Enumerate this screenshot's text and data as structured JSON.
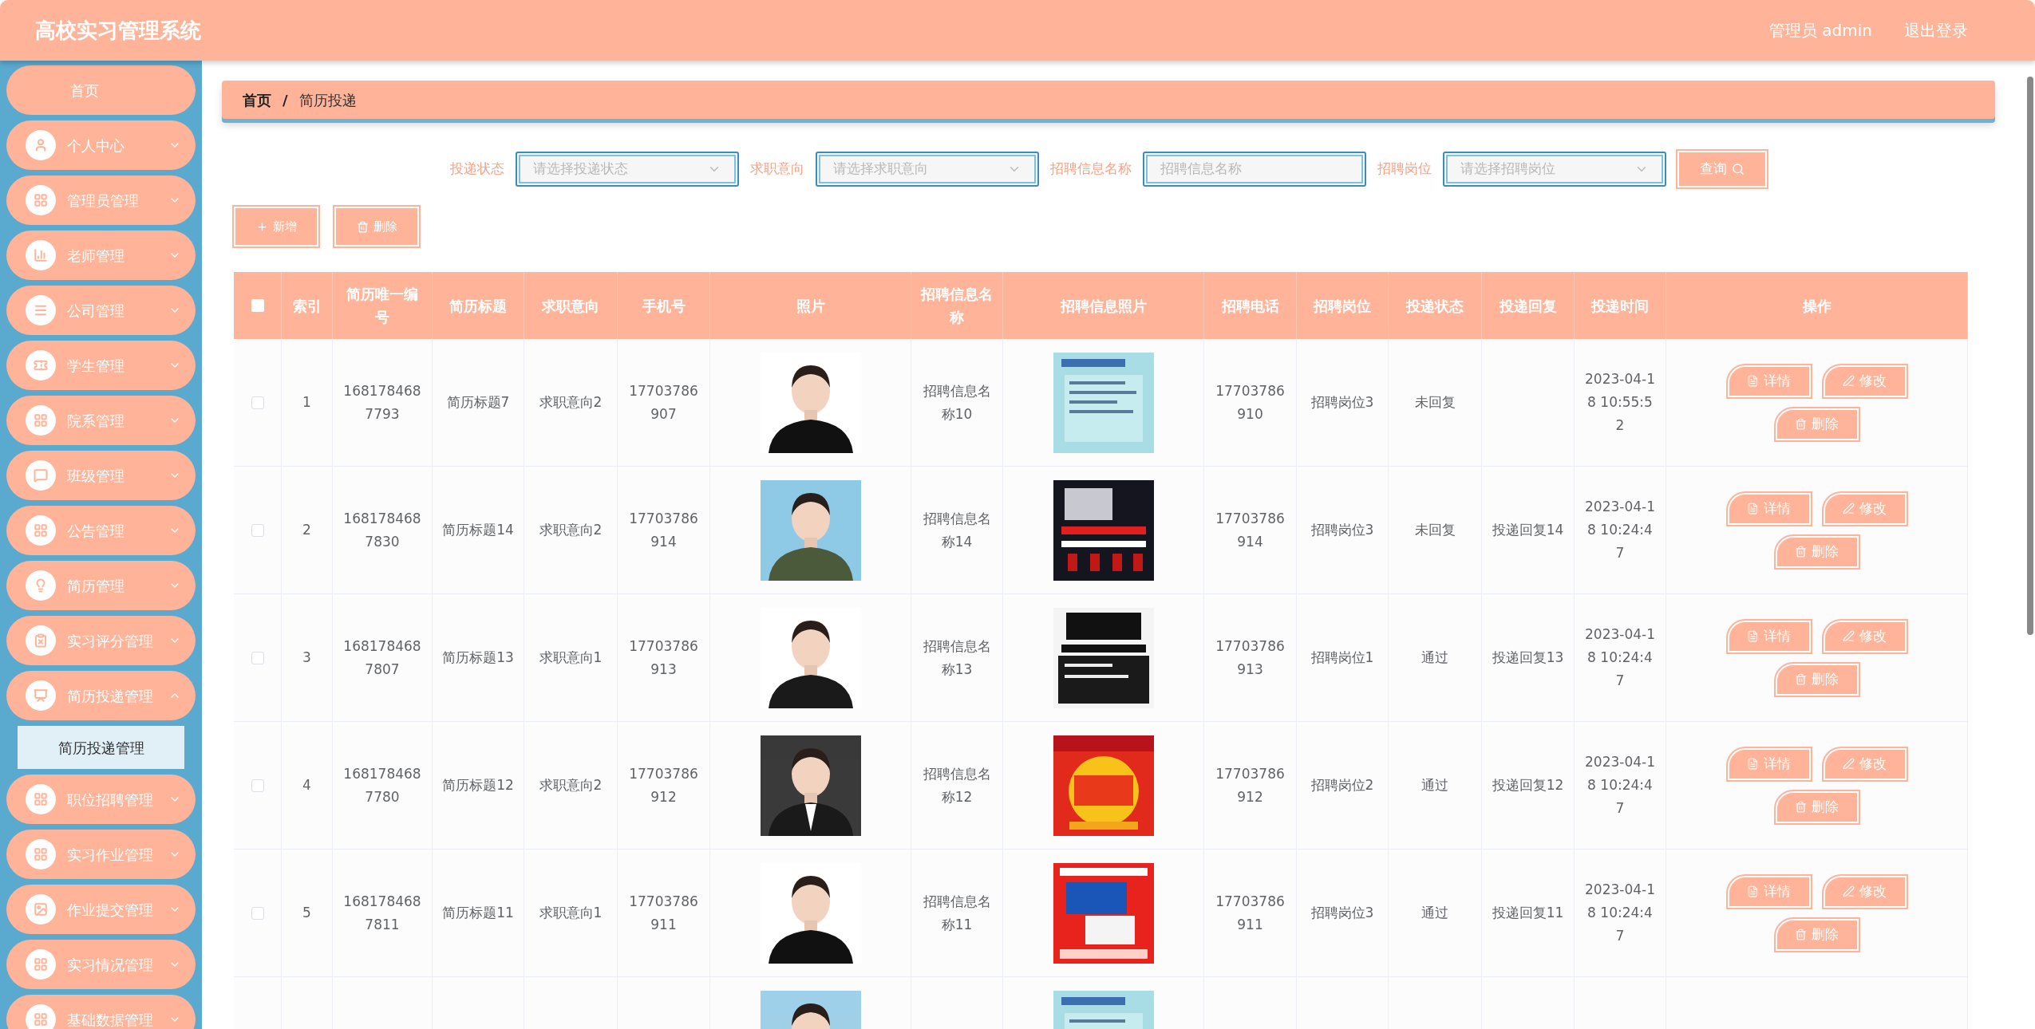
{
  "header": {
    "title": "高校实习管理系统",
    "user": "管理员 admin",
    "logout": "退出登录"
  },
  "sidebar": {
    "items": [
      {
        "label": "首页",
        "kind": "link"
      },
      {
        "label": "个人中心",
        "kind": "menu",
        "expanded": false
      },
      {
        "label": "管理员管理",
        "kind": "menu",
        "expanded": false
      },
      {
        "label": "老师管理",
        "kind": "menu",
        "expanded": false
      },
      {
        "label": "公司管理",
        "kind": "menu",
        "expanded": false
      },
      {
        "label": "学生管理",
        "kind": "menu",
        "expanded": false
      },
      {
        "label": "院系管理",
        "kind": "menu",
        "expanded": false
      },
      {
        "label": "班级管理",
        "kind": "menu",
        "expanded": false
      },
      {
        "label": "公告管理",
        "kind": "menu",
        "expanded": false
      },
      {
        "label": "简历管理",
        "kind": "menu",
        "expanded": false
      },
      {
        "label": "实习评分管理",
        "kind": "menu",
        "expanded": false
      },
      {
        "label": "简历投递管理",
        "kind": "menu",
        "expanded": true,
        "children": [
          {
            "label": "简历投递管理",
            "selected": true
          }
        ]
      },
      {
        "label": "职位招聘管理",
        "kind": "menu",
        "expanded": false
      },
      {
        "label": "实习作业管理",
        "kind": "menu",
        "expanded": false
      },
      {
        "label": "作业提交管理",
        "kind": "menu",
        "expanded": false
      },
      {
        "label": "实习情况管理",
        "kind": "menu",
        "expanded": false
      },
      {
        "label": "基础数据管理",
        "kind": "menu",
        "expanded": false
      }
    ]
  },
  "breadcrumb": {
    "items": [
      "首页",
      "简历投递"
    ],
    "separator": "/"
  },
  "filters": [
    {
      "label": "投递状态",
      "kind": "select",
      "placeholder": "请选择投递状态"
    },
    {
      "label": "求职意向",
      "kind": "select",
      "placeholder": "请选择求职意向"
    },
    {
      "label": "招聘信息名称",
      "kind": "input",
      "placeholder": "招聘信息名称"
    },
    {
      "label": "招聘岗位",
      "kind": "select",
      "placeholder": "请选择招聘岗位"
    }
  ],
  "search_button": "查询",
  "toolbar": [
    "新增",
    "删除"
  ],
  "table": {
    "select_all": {
      "checked": false
    },
    "columns": [
      "索引",
      "简历唯一编号",
      "简历标题",
      "求职意向",
      "手机号",
      "照片",
      "招聘信息名称",
      "招聘信息照片",
      "招聘电话",
      "招聘岗位",
      "投递状态",
      "投递回复",
      "投递时间",
      "操作"
    ],
    "rows": [
      {
        "checked": false,
        "index": "1",
        "id": "1681784687793",
        "title": "简历标题7",
        "intent": "求职意向2",
        "phone": "17703786907",
        "photo": {
          "kind": "picture"
        },
        "post_name": "招聘信息名称10",
        "poster": {
          "kind": "picture"
        },
        "tel": "17703786910",
        "position": "招聘岗位3",
        "status": "未回复",
        "time": "2023-04-18 10:55:52",
        "actions": [
          "详情",
          "修改",
          "删除"
        ]
      },
      {
        "checked": false,
        "index": "2",
        "id": "1681784687830",
        "title": "简历标题14",
        "intent": "求职意向2",
        "phone": "17703786914",
        "photo": {
          "kind": "picture"
        },
        "post_name": "招聘信息名称14",
        "poster": {
          "kind": "picture"
        },
        "tel": "17703786914",
        "position": "招聘岗位3",
        "status": "未回复",
        "reply": "投递回复14",
        "time": "2023-04-18 10:24:47",
        "actions": [
          "详情",
          "修改",
          "删除"
        ]
      },
      {
        "checked": false,
        "index": "3",
        "id": "1681784687807",
        "title": "简历标题13",
        "intent": "求职意向1",
        "phone": "17703786913",
        "photo": {
          "kind": "picture"
        },
        "post_name": "招聘信息名称13",
        "poster": {
          "kind": "picture"
        },
        "tel": "17703786913",
        "position": "招聘岗位1",
        "status": "通过",
        "reply": "投递回复13",
        "time": "2023-04-18 10:24:47",
        "actions": [
          "详情",
          "修改",
          "删除"
        ]
      },
      {
        "checked": false,
        "index": "4",
        "id": "1681784687780",
        "title": "简历标题12",
        "intent": "求职意向2",
        "phone": "17703786912",
        "photo": {
          "kind": "picture"
        },
        "post_name": "招聘信息名称12",
        "poster": {
          "kind": "picture"
        },
        "tel": "17703786912",
        "position": "招聘岗位2",
        "status": "通过",
        "reply": "投递回复12",
        "time": "2023-04-18 10:24:47",
        "actions": [
          "详情",
          "修改",
          "删除"
        ]
      },
      {
        "checked": false,
        "index": "5",
        "id": "1681784687811",
        "title": "简历标题11",
        "intent": "求职意向1",
        "phone": "17703786911",
        "photo": {
          "kind": "picture"
        },
        "post_name": "招聘信息名称11",
        "poster": {
          "kind": "picture"
        },
        "tel": "17703786911",
        "position": "招聘岗位3",
        "status": "通过",
        "reply": "投递回复11",
        "time": "2023-04-18 10:24:47",
        "actions": [
          "详情",
          "修改",
          "删除"
        ]
      },
      {
        "photo": {
          "kind": "picture"
        },
        "poster": {
          "kind": "picture"
        }
      }
    ]
  }
}
